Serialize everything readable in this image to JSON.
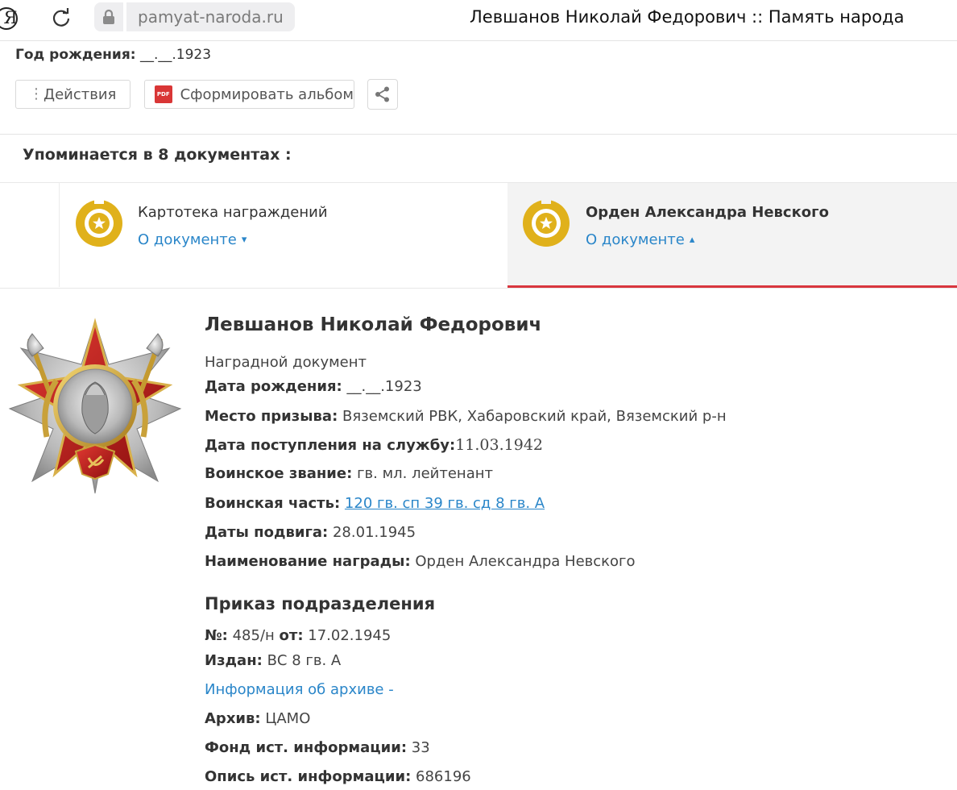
{
  "browser": {
    "url": "pamyat-naroda.ru",
    "title": "Левшанов Николай Федорович :: Память народа"
  },
  "header": {
    "birth_label": "Год рождения:",
    "birth_value": "__.__.1923"
  },
  "toolbar": {
    "actions_label": "Действия",
    "album_label": "Сформировать альбом"
  },
  "mentions": "Упоминается в 8 документах :",
  "documents": [
    {
      "title": "Картотека награждений",
      "link": "О документе",
      "chevron": "▾"
    },
    {
      "title": "Орден Александра Невского",
      "link": "О документе",
      "chevron": "▴"
    }
  ],
  "award": {
    "name": "Левшанов Николай Федорович",
    "doc_type": "Наградной документ",
    "rows": [
      {
        "label": "Дата рождения:",
        "value": "__.__.1923"
      },
      {
        "label": "Место призыва:",
        "value": "Вяземский РВК, Хабаровский край, Вяземский р-н"
      },
      {
        "label": "Дата поступления на службу:",
        "value": "11.03.1942"
      },
      {
        "label": "Воинское звание:",
        "value": "гв. мл. лейтенант"
      },
      {
        "label": "Воинская часть:",
        "value": "120 гв. сп 39 гв. сд 8 гв. А"
      },
      {
        "label": "Даты подвига:",
        "value": "28.01.1945"
      },
      {
        "label": "Наименование награды:",
        "value": "Орден Александра Невского"
      }
    ]
  },
  "order": {
    "heading": "Приказ подразделения",
    "number_label": "№:",
    "number_value": "485/н",
    "from_label": "от:",
    "from_value": "17.02.1945",
    "issued_label": "Издан:",
    "issued_value": "ВС 8 гв. А",
    "archive_link": "Информация об архиве -",
    "archive_label": "Архив:",
    "archive_value": "ЦАМО",
    "fond_label": "Фонд ист. информации:",
    "fond_value": "33",
    "opis_label": "Опись ист. информации:",
    "opis_value": "686196"
  },
  "colors": {
    "accent_red": "#d9363e",
    "link_blue": "#2a86c9",
    "medal_gold": "#e0b11b"
  }
}
